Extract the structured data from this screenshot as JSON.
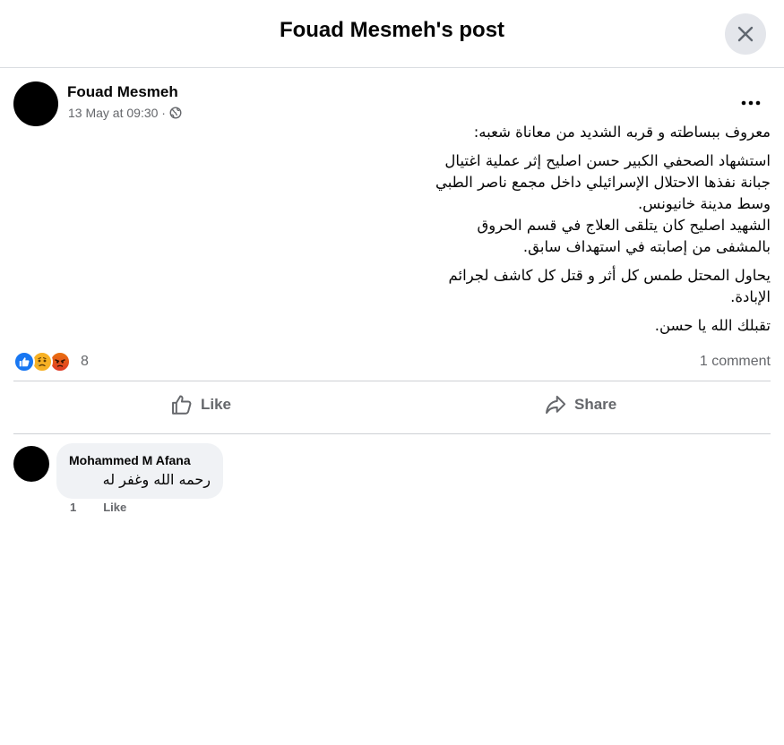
{
  "dialog": {
    "title": "Fouad Mesmeh's post",
    "close_icon": "close-icon"
  },
  "post": {
    "author": "Fouad Mesmeh",
    "timestamp": "13 May at 09:30 ·",
    "audience_icon": "globe-icon",
    "more_icon": "more-horizontal-icon",
    "paragraphs": [
      "معروف ببساطته و قربه الشديد من معاناة شعبه:",
      "استشهاد الصحفي الكبير حسن اصليح إثر عملية اغتيال \nجبانة نفذها الاحتلال الإسرائيلي داخل مجمع ناصر الطبي \nوسط مدينة خانيونس.\nالشهيد اصليح كان يتلقى العلاج في قسم الحروق \nبالمشفى من إصابته في استهداف سابق.",
      "يحاول المحتل طمس كل أثر  و قتل  كل كاشف لجرائم \nالإبادة.",
      "تقبلك الله يا حسن."
    ],
    "reactions": [
      "like",
      "sad",
      "angry"
    ],
    "reaction_count": "8",
    "comment_count": "1 comment"
  },
  "actions": {
    "like_label": "Like",
    "share_label": "Share"
  },
  "comments": [
    {
      "author": "Mohammed M Afana",
      "text": "رحمه الله وغفر له",
      "age": "1",
      "like_label": "Like"
    }
  ],
  "colors": {
    "primary_text": "#050505",
    "secondary_text": "#65676b",
    "like_blue": "#1877f2",
    "bubble_bg": "#f0f2f5",
    "divider": "#ced0d4"
  }
}
